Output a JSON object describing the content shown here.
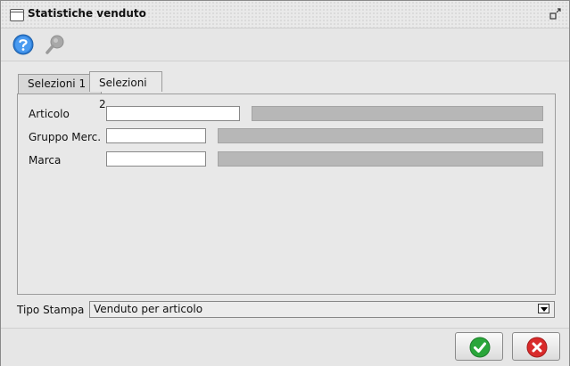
{
  "window": {
    "title": "Statistiche venduto"
  },
  "icons": {
    "window": "window-icon",
    "restore": "restore-icon",
    "help": "help-icon",
    "search": "search-icon",
    "ok": "check-icon",
    "cancel": "close-icon"
  },
  "tabs": [
    {
      "label": "Selezioni 1",
      "active": false
    },
    {
      "label": "Selezioni 2",
      "active": true
    }
  ],
  "fields": [
    {
      "label": "Articolo",
      "value": "",
      "description": ""
    },
    {
      "label": "Gruppo Merc.",
      "value": "",
      "description": ""
    },
    {
      "label": "Marca",
      "value": "",
      "description": ""
    }
  ],
  "tipo_stampa": {
    "label": "Tipo Stampa",
    "value": "Venduto per articolo"
  },
  "colors": {
    "ok": "#2aa63a",
    "cancel": "#d92a2a",
    "help": "#2f7fd8"
  }
}
